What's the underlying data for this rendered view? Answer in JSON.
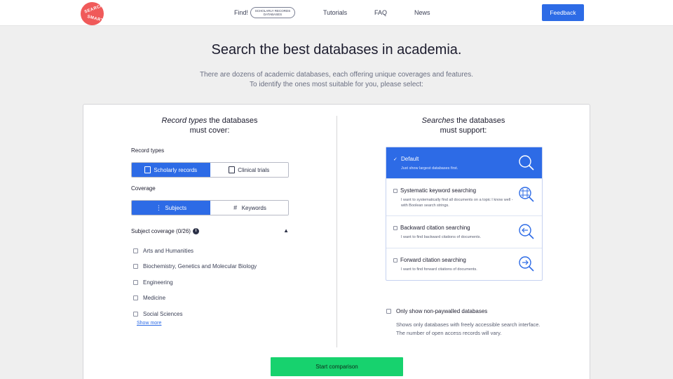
{
  "logo": {
    "line1": "SEARCH",
    "line2": "SMART",
    "color": "#f05a5a"
  },
  "nav": {
    "find_label": "Find!",
    "find_pill": "SCHOLARLY RECORDS DATABASES",
    "tutorials": "Tutorials",
    "faq": "FAQ",
    "news": "News",
    "feedback": "Feedback"
  },
  "hero": {
    "title": "Search the best databases in academia.",
    "subtitle_line1": "There are dozens of academic databases, each offering unique coverages and features.",
    "subtitle_line2": "To identify the ones most suitable for you, please select:"
  },
  "left": {
    "heading_em": "Record types",
    "heading_rest": " the databases",
    "heading_line2": "must cover:",
    "record_types_label": "Record types",
    "record_types": [
      {
        "label": "Scholarly records",
        "active": true,
        "icon": "document-icon"
      },
      {
        "label": "Clinical trials",
        "active": false,
        "icon": "clipboard-icon"
      }
    ],
    "coverage_label": "Coverage",
    "coverage": [
      {
        "label": "Subjects",
        "active": true,
        "icon": "tree-icon"
      },
      {
        "label": "Keywords",
        "active": false,
        "icon": "hash-icon"
      }
    ],
    "subject_coverage_label": "Subject coverage (0/26)",
    "subjects": [
      "Arts and Humanities",
      "Biochemistry, Genetics and Molecular Biology",
      "Engineering",
      "Medicine",
      "Social Sciences"
    ],
    "show_more": "Show more"
  },
  "right": {
    "heading_em": "Searches",
    "heading_rest": " the databases",
    "heading_line2": "must support:",
    "options": [
      {
        "title": "Default",
        "desc": "Just show largest databases first.",
        "active": true,
        "icon": "search-icon"
      },
      {
        "title": "Systematic keyword searching",
        "desc": "I want to systematically find all documents on a topic I know well - with Boolean search strings.",
        "active": false,
        "icon": "grid-search-icon"
      },
      {
        "title": "Backward citation searching",
        "desc": "I want to find backward citations of documents.",
        "active": false,
        "icon": "backward-search-icon"
      },
      {
        "title": "Forward citation searching",
        "desc": "I want to find forward citations of documents.",
        "active": false,
        "icon": "forward-search-icon"
      }
    ],
    "paywall_label": "Only show non-paywalled databases",
    "paywall_desc": "Shows only databases with freely accessible search interface. The number of open access records will vary."
  },
  "start_button": "Start comparison",
  "colors": {
    "accent": "#2d6be6",
    "start": "#17d26e",
    "background": "#efefef"
  }
}
